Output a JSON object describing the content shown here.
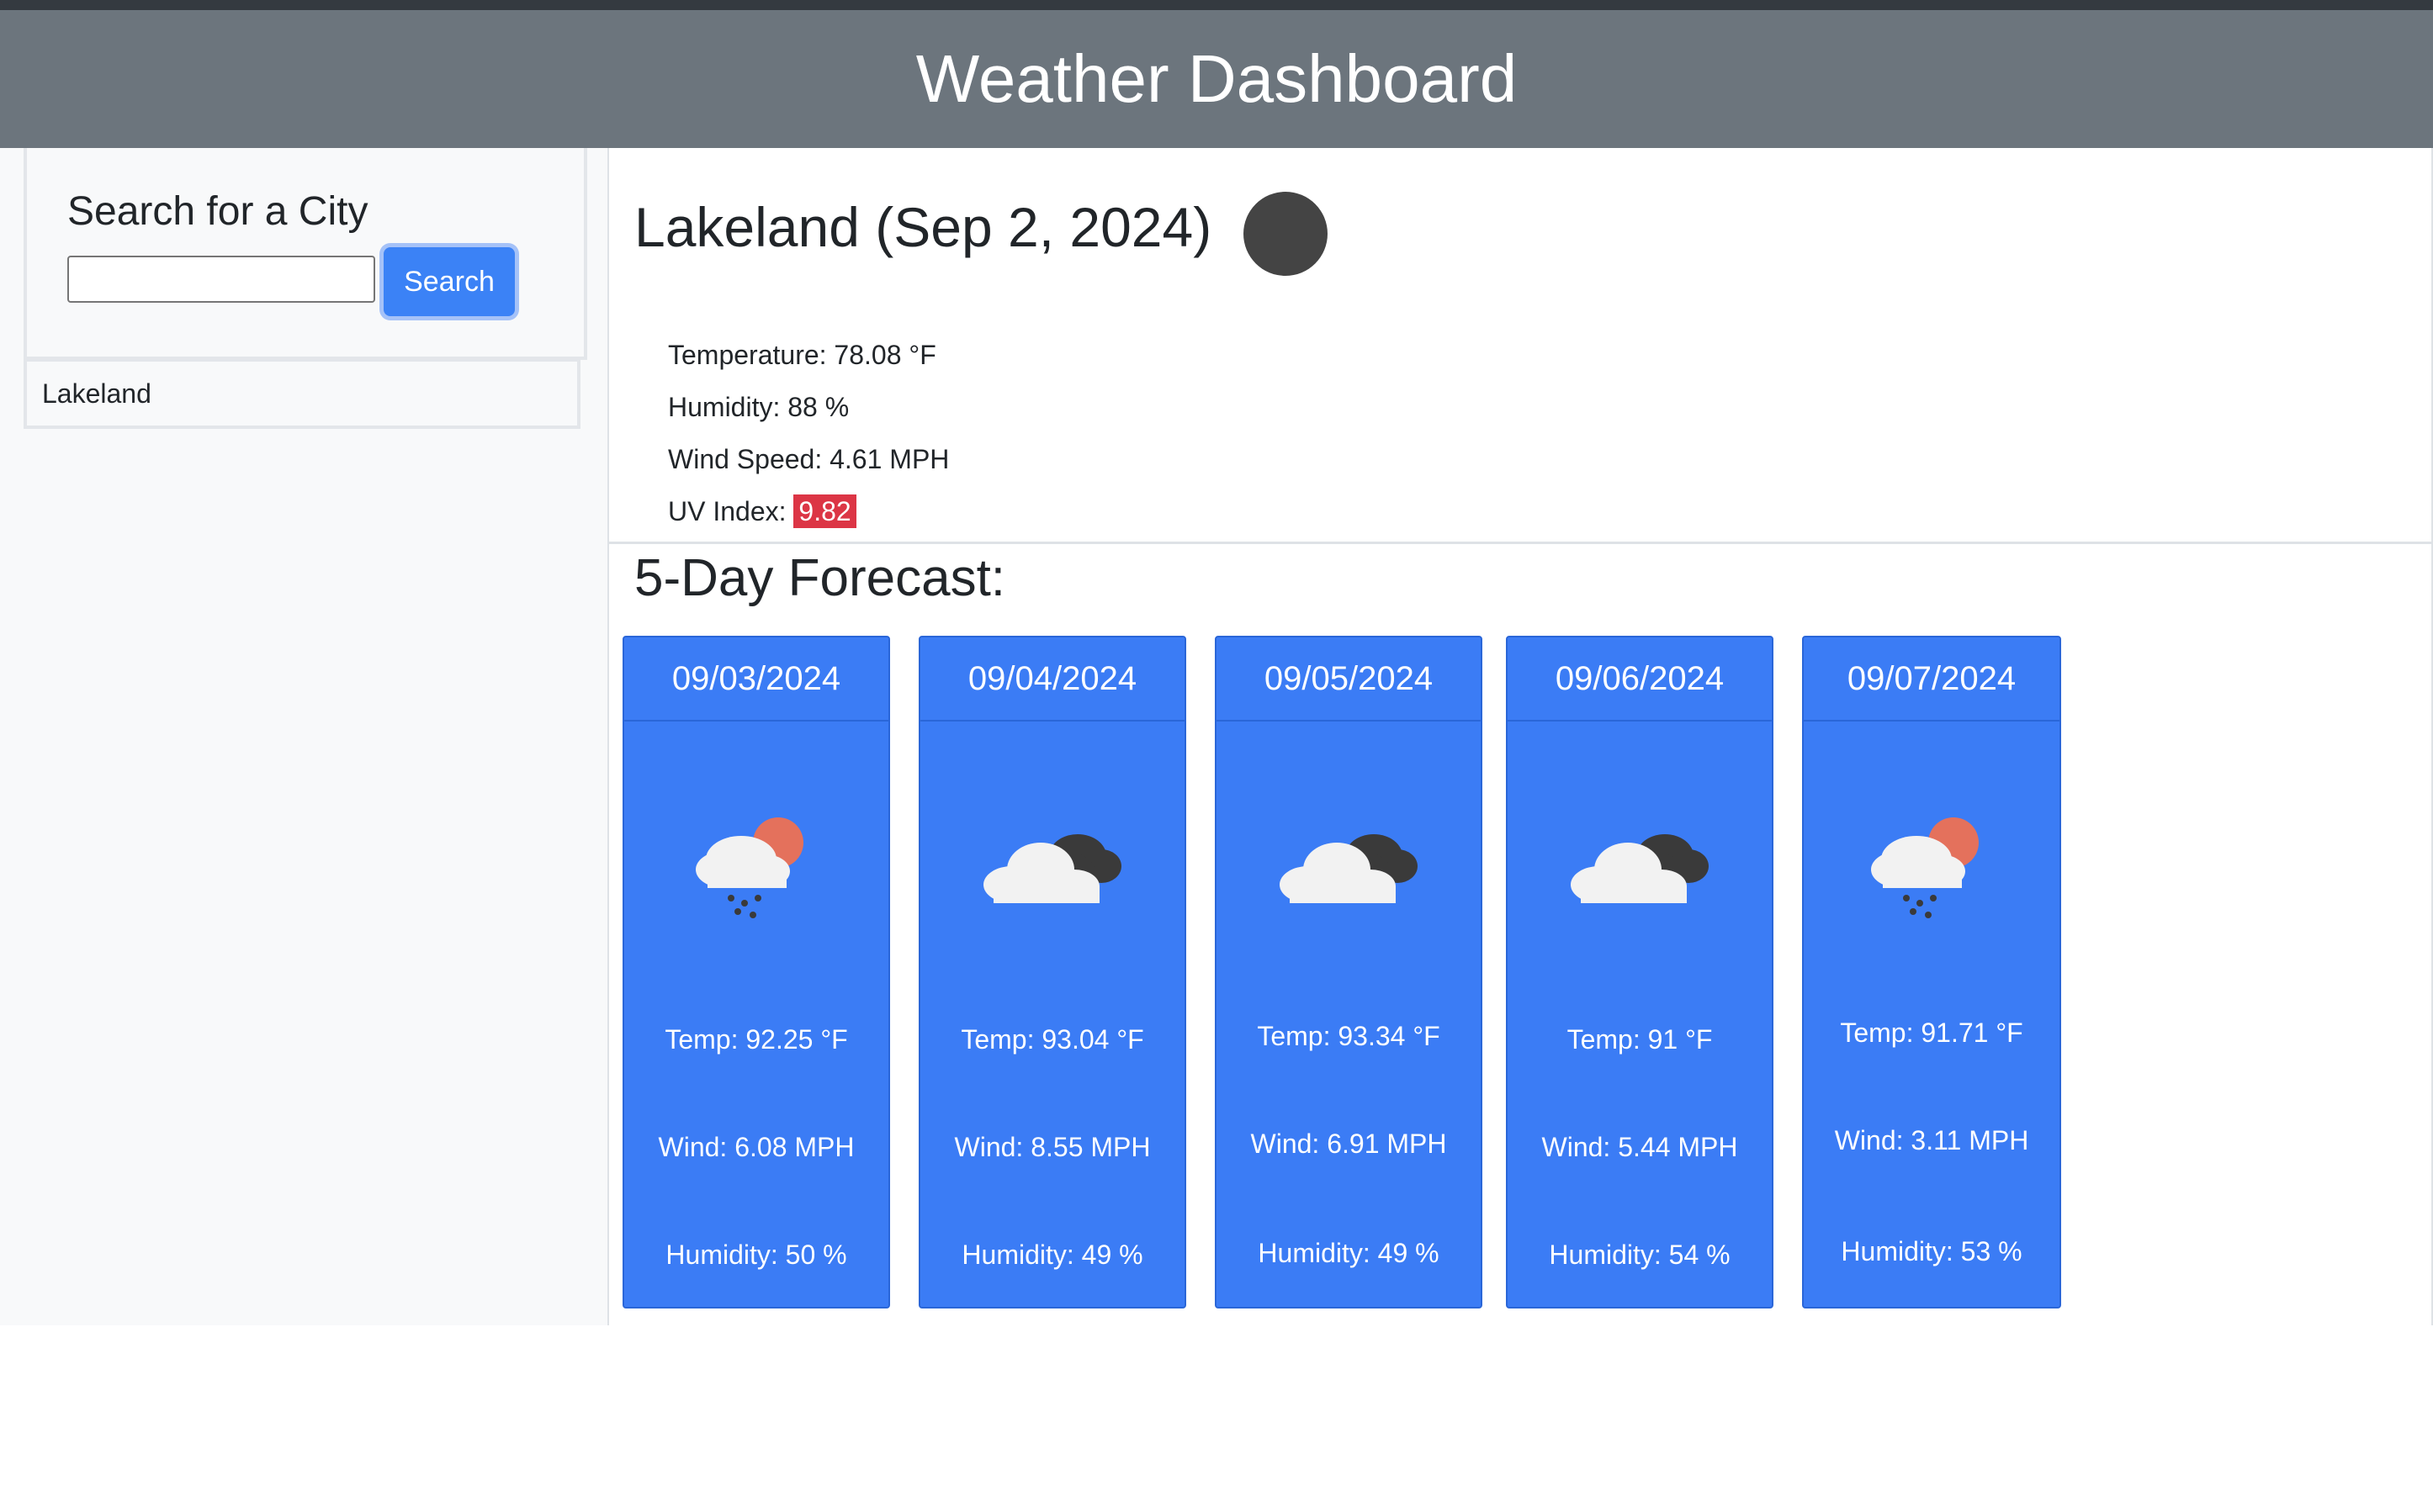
{
  "header": {
    "title": "Weather Dashboard"
  },
  "search": {
    "title": "Search for a City",
    "input_value": "",
    "button_label": "Search"
  },
  "history": [
    {
      "label": "Lakeland"
    }
  ],
  "current": {
    "title": "Lakeland (Sep 2, 2024)",
    "temperature": "Temperature: 78.08 °F",
    "humidity": "Humidity: 88 %",
    "wind": "Wind Speed: 4.61 MPH",
    "uv_label": "UV Index:",
    "uv_value": "9.82",
    "uv_color": "#dc3545"
  },
  "forecast": {
    "title": "5-Day Forecast:",
    "days": [
      {
        "date": "09/03/2024",
        "icon": "rain-sun-icon",
        "temp": "Temp: 92.25 °F",
        "wind": "Wind: 6.08 MPH",
        "humidity": "Humidity: 50 %"
      },
      {
        "date": "09/04/2024",
        "icon": "clouds-icon",
        "temp": "Temp: 93.04 °F",
        "wind": "Wind: 8.55 MPH",
        "humidity": "Humidity: 49 %"
      },
      {
        "date": "09/05/2024",
        "icon": "clouds-icon",
        "temp": "Temp: 93.34 °F",
        "wind": "Wind: 6.91 MPH",
        "humidity": "Humidity: 49 %"
      },
      {
        "date": "09/06/2024",
        "icon": "clouds-icon",
        "temp": "Temp: 91 °F",
        "wind": "Wind: 5.44 MPH",
        "humidity": "Humidity: 54 %"
      },
      {
        "date": "09/07/2024",
        "icon": "rain-sun-icon",
        "temp": "Temp: 91.71 °F",
        "wind": "Wind: 3.11 MPH",
        "humidity": "Humidity: 53 %"
      }
    ]
  },
  "colors": {
    "header_bg": "#6c757d",
    "card_bg": "#3b7cf5",
    "button_bg": "#3b82f6"
  }
}
